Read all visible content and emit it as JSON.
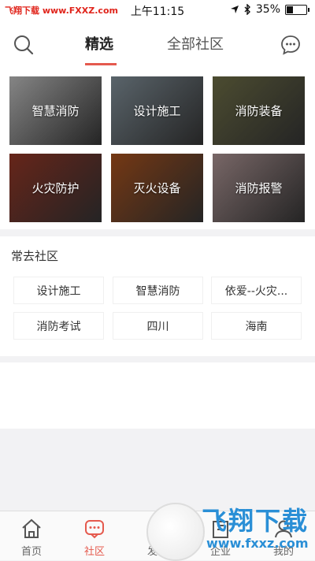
{
  "status_bar": {
    "watermark": "飞翔下载 www.FXXZ.com",
    "time": "上午11:15",
    "battery": "35%",
    "battery_level": 0.35
  },
  "nav": {
    "tabs": [
      {
        "label": "精选",
        "active": true
      },
      {
        "label": "全部社区",
        "active": false
      }
    ],
    "accent_color": "#e55a4e"
  },
  "categories": [
    {
      "label": "智慧消防",
      "bg": "#b9b9b9"
    },
    {
      "label": "设计施工",
      "bg": "#7d8b94"
    },
    {
      "label": "消防装备",
      "bg": "#6a6a44"
    },
    {
      "label": "火灾防护",
      "bg": "#8e3424"
    },
    {
      "label": "灭火设备",
      "bg": "#a24e1c"
    },
    {
      "label": "消防报警",
      "bg": "#a78f8f"
    }
  ],
  "frequent": {
    "title": "常去社区",
    "items": [
      "设计施工",
      "智慧消防",
      "依爱--火灾...",
      "消防考试",
      "四川",
      "海南"
    ]
  },
  "tabbar": {
    "items": [
      {
        "label": "首页",
        "icon": "home-icon",
        "active": false
      },
      {
        "label": "社区",
        "icon": "community-icon",
        "active": true
      },
      {
        "label": "发布",
        "icon": "publish-icon",
        "active": false
      },
      {
        "label": "企业",
        "icon": "enterprise-icon",
        "active": false
      },
      {
        "label": "我的",
        "icon": "profile-icon",
        "active": false
      }
    ]
  },
  "overlay_watermark": {
    "big": "飞翔下载",
    "small": "www.fxxz.com"
  }
}
